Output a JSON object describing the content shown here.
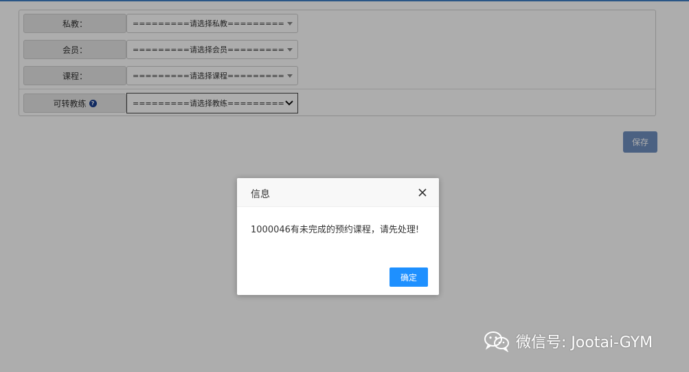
{
  "form": {
    "rows": [
      {
        "label": "私教：",
        "value": "=========请选择私教========="
      },
      {
        "label": "会员：",
        "value": "=========请选择会员========="
      },
      {
        "label": "课程：",
        "value": "=========请选择课程========="
      },
      {
        "label": "可转教练",
        "value": "=========请选择教练========="
      }
    ],
    "help_glyph": "?",
    "save_label": "保存"
  },
  "dialog": {
    "title": "信息",
    "message": "1000046有未完成的预约课程，请先处理!",
    "confirm_label": "确定"
  },
  "watermark": {
    "text": "微信号: Jootai-GYM",
    "icon": "wechat-icon"
  },
  "colors": {
    "accent_blue": "#1e90ff",
    "save_button": "#6f8fc0",
    "top_line": "#3f7fc6"
  }
}
